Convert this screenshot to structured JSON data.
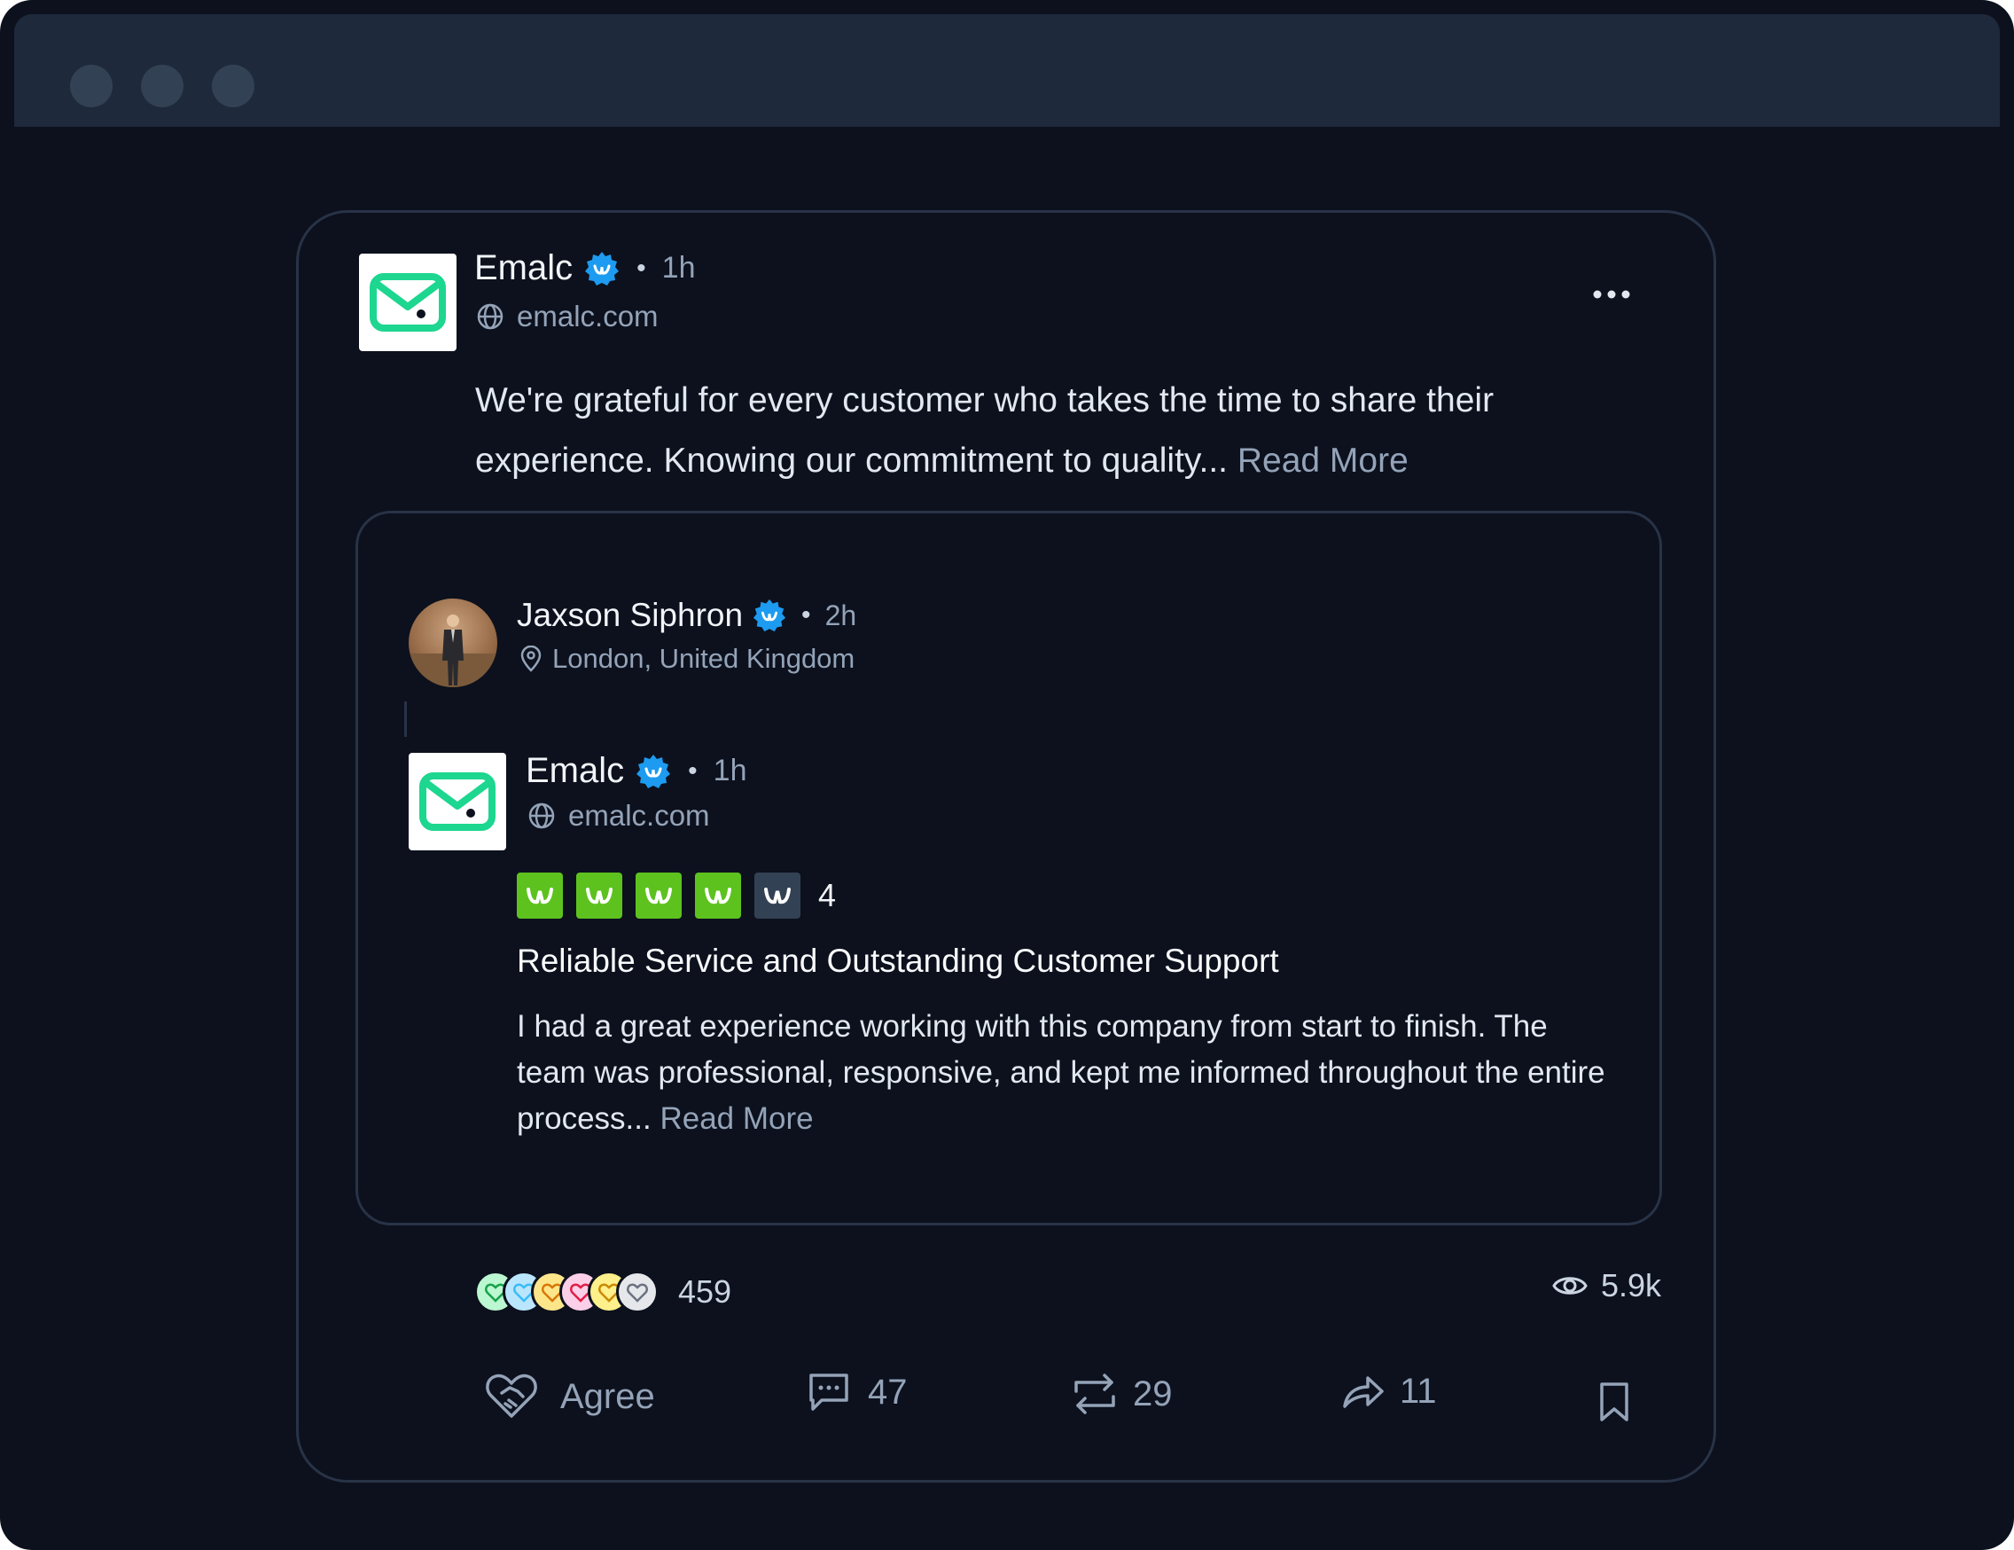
{
  "window": {
    "traffic_lights": [
      "close",
      "minimize",
      "maximize"
    ]
  },
  "post": {
    "author": {
      "name": "Emalc",
      "verified": true,
      "time": "1h",
      "website": "emalc.com",
      "logo_icon": "mail-logo-icon"
    },
    "text": "We're grateful for every customer who takes the time to share their experience. Knowing our commitment to quality...",
    "read_more": "Read More",
    "menu_icon": "more-horizontal-icon"
  },
  "review": {
    "reviewer": {
      "name": "Jaxson Siphron",
      "verified": true,
      "time": "2h",
      "location": "London, United Kingdom"
    },
    "business": {
      "name": "Emalc",
      "verified": true,
      "time": "1h",
      "website": "emalc.com"
    },
    "rating": 4,
    "rating_label": "4",
    "rating_max": 5,
    "title": "Reliable Service and Outstanding Customer Support",
    "text": "I had a great experience working with this company from start to finish. The team was professional, responsive, and kept me informed throughout the entire process...",
    "read_more": "Read More"
  },
  "stats": {
    "reactions_count": "459",
    "views": "5.9k",
    "reaction_icons": [
      "agree-reaction-icon",
      "bulb-reaction-icon",
      "idea-reaction-icon",
      "love-reaction-icon",
      "laugh-reaction-icon",
      "support-reaction-icon"
    ]
  },
  "actions": {
    "agree_label": "Agree",
    "comments": "47",
    "reposts": "29",
    "shares": "11"
  },
  "colors": {
    "background": "#0c111d",
    "titlebar": "#1e293b",
    "border": "#283347",
    "brand_green": "#1dd68f",
    "rating_green": "#5dc21e",
    "verified_blue": "#1d9bf0"
  }
}
